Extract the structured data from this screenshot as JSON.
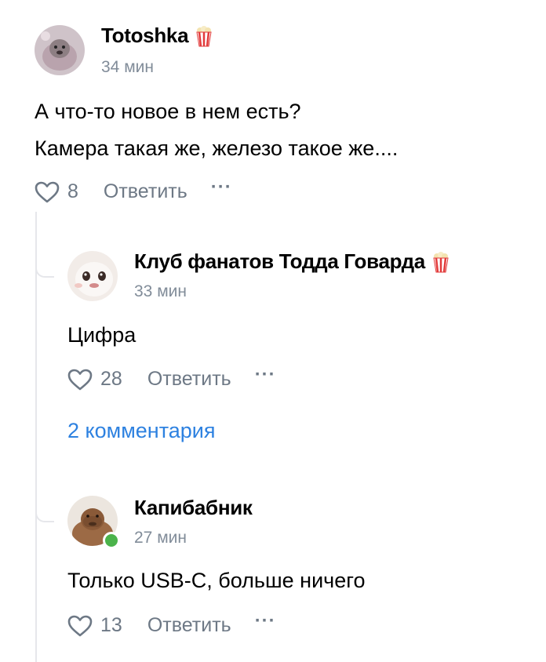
{
  "comments": [
    {
      "author": "Totoshka",
      "time": "34 мин",
      "lines": [
        "А что-то новое в нем есть?",
        "Камера такая же, железо такое же...."
      ],
      "likes": "8",
      "reply_label": "Ответить",
      "badge_icon": "popcorn-icon"
    },
    {
      "author": "Клуб фанатов Тодда Говарда",
      "time": "33 мин",
      "lines": [
        "Цифра"
      ],
      "likes": "28",
      "reply_label": "Ответить",
      "badge_icon": "popcorn-icon",
      "more_replies": "2 комментария"
    },
    {
      "author": "Капибабник",
      "time": "27 мин",
      "lines": [
        "Только USB-C, больше ничего"
      ],
      "likes": "13",
      "reply_label": "Ответить",
      "online": true
    }
  ],
  "colors": {
    "link": "#2d81e0",
    "muted": "#6d7885",
    "online": "#4bb34b",
    "thread_line": "#e6e7eb"
  }
}
